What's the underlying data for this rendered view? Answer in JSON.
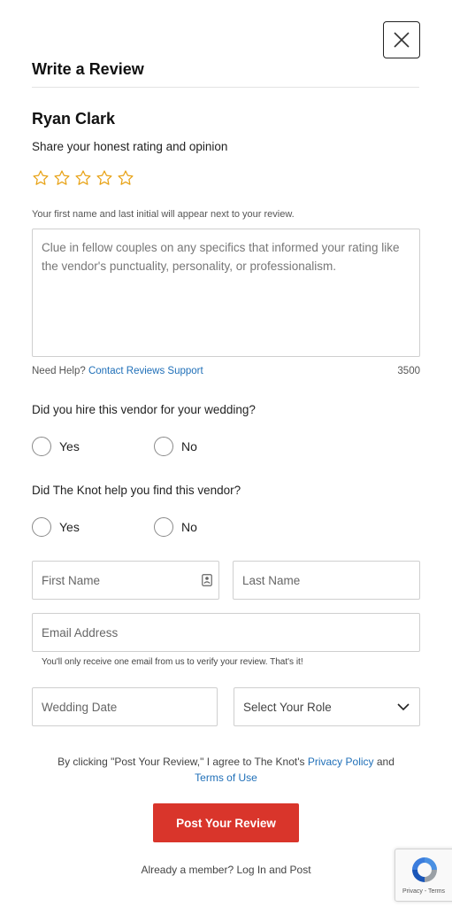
{
  "modal": {
    "title": "Write a Review",
    "close_icon": "close-icon"
  },
  "vendor": {
    "name": "Ryan Clark"
  },
  "rating": {
    "prompt": "Share your honest rating and opinion",
    "max_stars": 5,
    "selected": 0,
    "star_color": "#e8a317"
  },
  "review": {
    "name_note": "Your first name and last initial will appear next to your review.",
    "placeholder": "Clue in fellow couples on any specifics that informed your rating like the vendor's punctuality, personality, or professionalism.",
    "value": "",
    "help_prefix": "Need Help?",
    "help_link": "Contact Reviews Support",
    "char_count": "3500"
  },
  "question_hired": {
    "text": "Did you hire this vendor for your wedding?",
    "options": [
      "Yes",
      "No"
    ]
  },
  "question_knot": {
    "text": "Did The Knot help you find this vendor?",
    "options": [
      "Yes",
      "No"
    ]
  },
  "fields": {
    "first_name_placeholder": "First Name",
    "last_name_placeholder": "Last Name",
    "email_placeholder": "Email Address",
    "email_note": "You'll only receive one email from us to verify your review. That's it!",
    "wedding_date_placeholder": "Wedding Date",
    "role_placeholder": "Select Your Role"
  },
  "legal": {
    "prefix": "By clicking \"Post Your Review,\" I agree to The Knot's",
    "privacy_link": "Privacy Policy",
    "and": "and",
    "terms_link": "Terms of Use"
  },
  "actions": {
    "post_label": "Post Your Review",
    "post_color": "#d9352b",
    "member_text": "Already a member? Log In and Post"
  },
  "recaptcha": {
    "text": "Privacy - Terms"
  },
  "colors": {
    "link": "#1f6fb8",
    "border": "#cfcfcf"
  }
}
